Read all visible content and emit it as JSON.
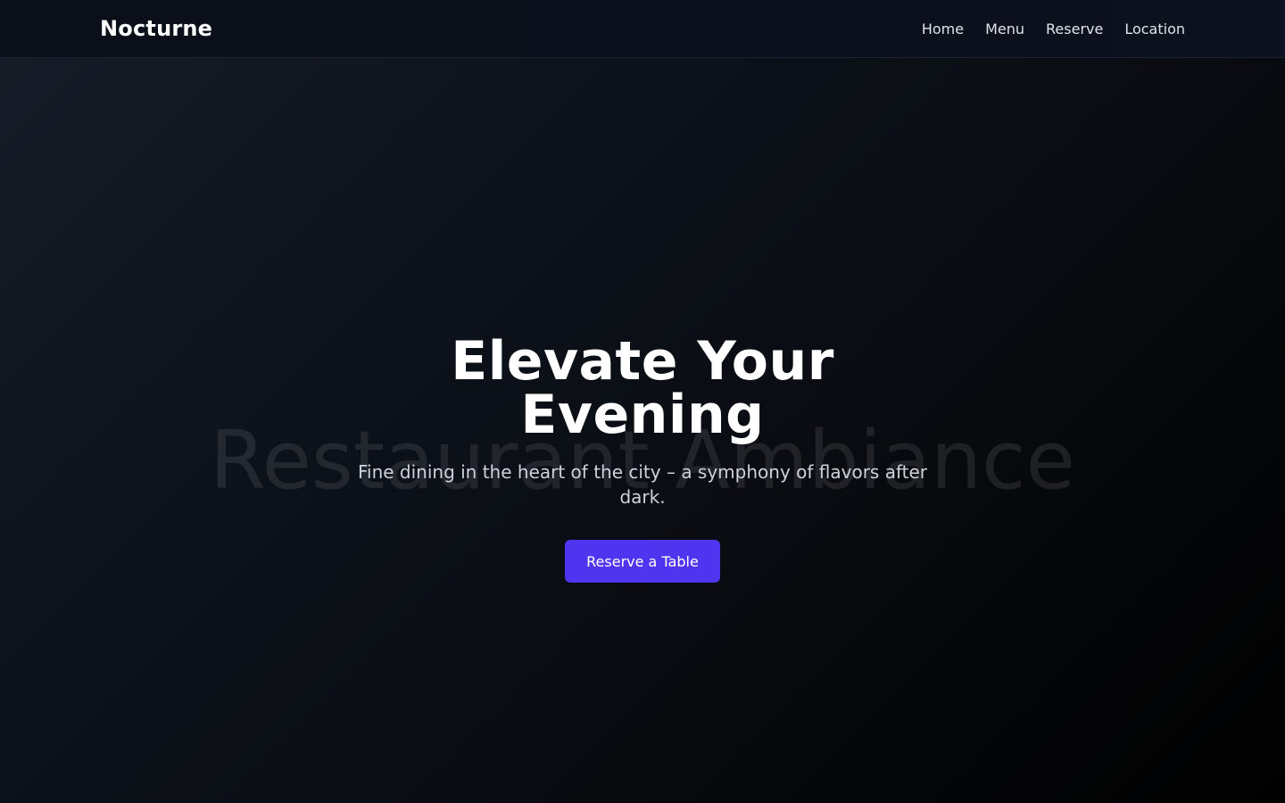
{
  "brand": {
    "name": "Nocturne"
  },
  "nav": {
    "items": [
      {
        "label": "Home"
      },
      {
        "label": "Menu"
      },
      {
        "label": "Reserve"
      },
      {
        "label": "Location"
      }
    ]
  },
  "hero": {
    "background_label": "Restaurant Ambiance",
    "title": "Elevate Your Evening",
    "subtitle": "Fine dining in the heart of the city – a symphony of flavors after dark.",
    "cta_label": "Reserve a Table"
  },
  "colors": {
    "accent": "#4f35f0",
    "nav_background": "#0b0f1a",
    "text_primary": "#ffffff",
    "text_secondary": "#cdd2db"
  }
}
